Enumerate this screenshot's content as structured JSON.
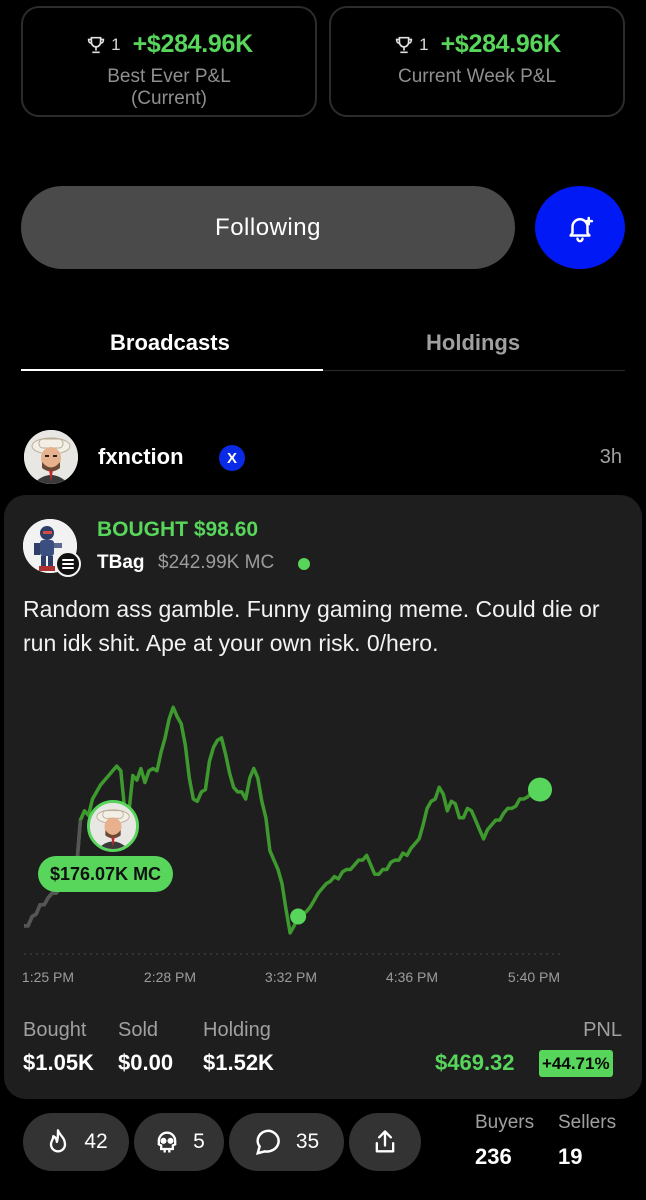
{
  "stats": [
    {
      "rank": "1",
      "value": "+$284.96K",
      "label": "Best Ever P&L (Current)"
    },
    {
      "rank": "1",
      "value": "+$284.96K",
      "label": "Current Week P&L"
    }
  ],
  "follow_button": "Following",
  "tabs": [
    {
      "label": "Broadcasts",
      "active": true
    },
    {
      "label": "Holdings",
      "active": false
    }
  ],
  "author": {
    "name": "fxnction",
    "badge": "X",
    "time_ago": "3h"
  },
  "post": {
    "action": "BOUGHT $98.60",
    "ticker": "TBag",
    "market_cap": "$242.99K MC",
    "text": "Random ass gamble. Funny gaming meme. Could die or run idk shit. Ape at your own risk. 0/hero.",
    "entry_mc": "$176.07K MC",
    "metrics": [
      {
        "label": "Bought",
        "value": "$1.05K"
      },
      {
        "label": "Sold",
        "value": "$0.00"
      },
      {
        "label": "Holding",
        "value": "$1.52K"
      }
    ],
    "pnl": {
      "label": "PNL",
      "value": "$469.32",
      "percent": "+44.71%"
    }
  },
  "chart_data": {
    "type": "line",
    "x_ticks": [
      "1:25 PM",
      "2:28 PM",
      "3:32 PM",
      "4:36 PM",
      "5:40 PM"
    ],
    "series_color": "#3e9a2f",
    "endpoint_color": "#57d65b",
    "trend": [
      0.06,
      0.06,
      0.1,
      0.11,
      0.15,
      0.15,
      0.18,
      0.2,
      0.2,
      0.22,
      0.25,
      0.27,
      0.28,
      0.3,
      0.51,
      0.55,
      0.53,
      0.6,
      0.63,
      0.66,
      0.68,
      0.7,
      0.72,
      0.74,
      0.72,
      0.55,
      0.54,
      0.7,
      0.68,
      0.73,
      0.67,
      0.72,
      0.73,
      0.72,
      0.8,
      0.86,
      0.94,
      0.99,
      0.95,
      0.92,
      0.83,
      0.69,
      0.6,
      0.59,
      0.63,
      0.64,
      0.76,
      0.82,
      0.85,
      0.86,
      0.79,
      0.71,
      0.65,
      0.63,
      0.63,
      0.6,
      0.69,
      0.73,
      0.69,
      0.59,
      0.52,
      0.38,
      0.34,
      0.3,
      0.24,
      0.13,
      0.03,
      0.06,
      0.1,
      0.11,
      0.12,
      0.14,
      0.17,
      0.2,
      0.22,
      0.24,
      0.25,
      0.27,
      0.26,
      0.29,
      0.3,
      0.3,
      0.32,
      0.34,
      0.34,
      0.36,
      0.32,
      0.28,
      0.28,
      0.3,
      0.3,
      0.33,
      0.34,
      0.34,
      0.37,
      0.36,
      0.39,
      0.41,
      0.43,
      0.49,
      0.56,
      0.59,
      0.6,
      0.65,
      0.62,
      0.55,
      0.59,
      0.58,
      0.52,
      0.52,
      0.56,
      0.55,
      0.51,
      0.47,
      0.43,
      0.47,
      0.49,
      0.51,
      0.51,
      0.54,
      0.56,
      0.56,
      0.57,
      0.6,
      0.6,
      0.61,
      0.63,
      0.63,
      0.64
    ],
    "entry_point_index": 14,
    "buy_point_index": 68
  },
  "reactions": [
    {
      "icon": "fire-icon",
      "count": "42"
    },
    {
      "icon": "skull-icon",
      "count": "5"
    },
    {
      "icon": "comment-icon",
      "count": "35"
    },
    {
      "icon": "share-icon",
      "count": ""
    }
  ],
  "buyers": {
    "label": "Buyers",
    "value": "236"
  },
  "sellers": {
    "label": "Sellers",
    "value": "19"
  }
}
